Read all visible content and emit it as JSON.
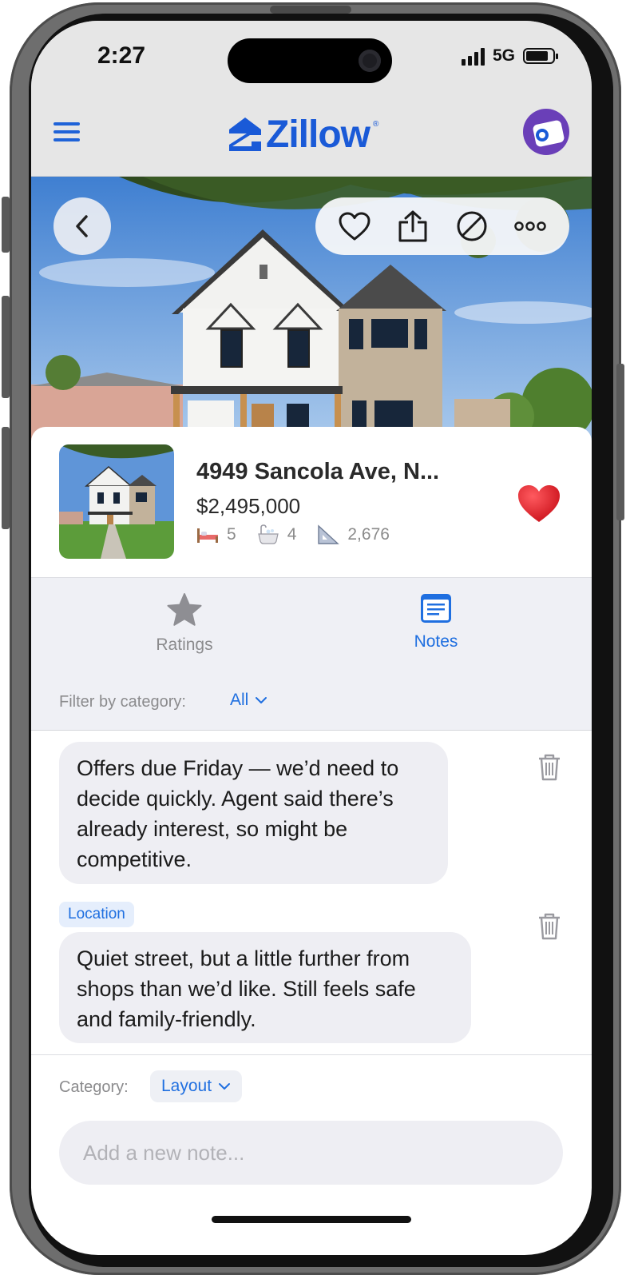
{
  "status_bar": {
    "time": "2:27",
    "network": "5G"
  },
  "header": {
    "logo_text": "Zillow",
    "logo_mark": "®",
    "accent_color": "#1a5ad7"
  },
  "listing": {
    "address": "4949 Sancola Ave, N...",
    "price": "$2,495,000",
    "beds": "5",
    "baths": "4",
    "sqft": "2,676",
    "favorited": true
  },
  "tabs": [
    {
      "label": "Ratings",
      "active": false
    },
    {
      "label": "Notes",
      "active": true
    }
  ],
  "filter": {
    "label": "Filter by category:",
    "value": "All"
  },
  "notes": [
    {
      "category": "",
      "text": "Offers due Friday — we’d need to decide quickly. Agent said there’s already interest, so might be competitive."
    },
    {
      "category": "Location",
      "text": "Quiet street, but a little further from shops than we’d like. Still feels safe and family-friendly."
    }
  ],
  "composer": {
    "category_label": "Category:",
    "category_value": "Layout",
    "placeholder": "Add a new note..."
  },
  "colors": {
    "link_blue": "#1f6fe0",
    "favorite_red": "#e0141e",
    "inactive_gray": "#8b8b8d"
  }
}
